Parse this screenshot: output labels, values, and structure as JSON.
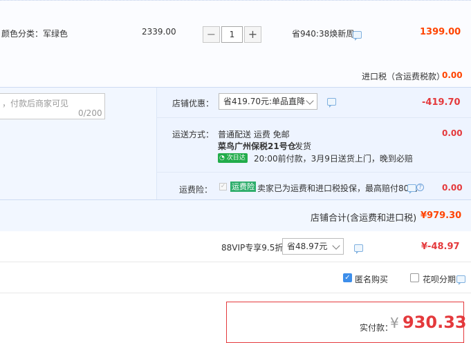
{
  "item": {
    "spec": "颜色分类：军绿色",
    "unit_price": "2339.00",
    "quantity": "1",
    "minus_label": "−",
    "plus_label": "+",
    "promo": "省940:38焕新周",
    "subtotal": "1399.00",
    "import_tax_label": "进口税（含运费税款）",
    "import_tax_value": "0.00"
  },
  "message": {
    "placeholder": "，付款后商家可见",
    "counter": "0/200"
  },
  "store_discount": {
    "label": "店铺优惠：",
    "selected": "省419.70元:单品直降",
    "value": "-419.70"
  },
  "shipping": {
    "label": "运送方式：",
    "method": "普通配送 运费 免邮",
    "warehouse": "菜鸟广州保税21号仓",
    "warehouse_action": "发货",
    "badge": "次日达",
    "promise": "20:00前付款，3月9日送货上门，晚到必赔",
    "value": "0.00"
  },
  "insurance": {
    "label": "运费险：",
    "tag": "运费险",
    "desc": "卖家已为运费和进口税投保，最高赔付80元",
    "help": "?",
    "value": "0.00"
  },
  "store_total": {
    "label": "店铺合计(含运费和进口税)",
    "value": "¥979.30"
  },
  "vip": {
    "label": "88VIP专享9.5折",
    "selected": "省48.97元",
    "value": "¥-48.97"
  },
  "options": {
    "anonymous_label": "匿名购买",
    "anonymous_checked": true,
    "huabei_label": "花呗分期",
    "huabei_checked": false
  },
  "payment": {
    "label": "实付款：",
    "currency": "¥",
    "amount": "930.33"
  },
  "colors": {
    "accent_red": "#e4393c",
    "price_orange": "#ff4400",
    "link_blue": "#3d8eea",
    "panel_blue": "#f2f7ff"
  }
}
